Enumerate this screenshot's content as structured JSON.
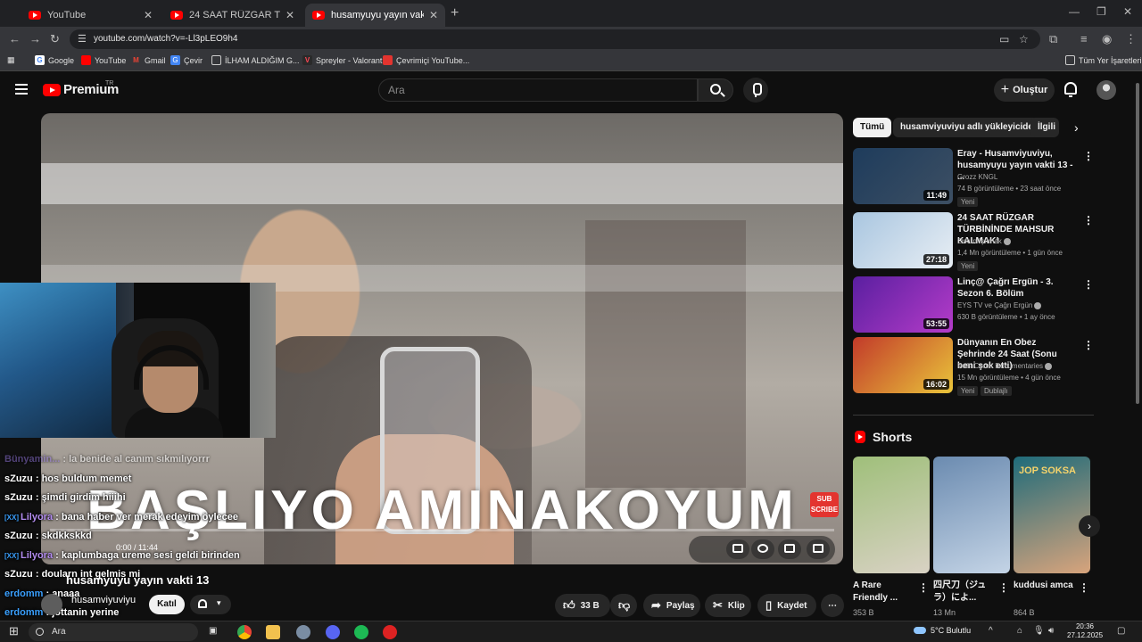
{
  "browser": {
    "tabs": [
      {
        "title": "YouTube",
        "active": false
      },
      {
        "title": "24 SAAT RÜZGAR TÜRBİNİNDE",
        "active": false
      },
      {
        "title": "husamyuyu yayın vakti 13 - You",
        "active": true
      }
    ],
    "url": "youtube.com/watch?v=-Ll3pLEO9h4",
    "bookmarks": [
      {
        "label": "Google",
        "icon": "google-icon"
      },
      {
        "label": "YouTube",
        "icon": "youtube-icon"
      },
      {
        "label": "Gmail",
        "icon": "gmail-icon"
      },
      {
        "label": "Çevir",
        "icon": "translate-icon"
      },
      {
        "label": "İLHAM ALDIĞIM G...",
        "icon": "folder-icon"
      },
      {
        "label": "Spreyler - Valorant",
        "icon": "valorant-icon"
      },
      {
        "label": "Çevrimiçi YouTube...",
        "icon": "converter-icon"
      }
    ],
    "all_bookmarks": "Tüm Yer İşaretleri"
  },
  "youtube": {
    "logo_text": "Premium",
    "logo_country": "TR",
    "search_placeholder": "Ara",
    "create_label": "Oluştur"
  },
  "video": {
    "overlay_text": "BAŞLIYO AMINAKOYUM",
    "sub_badge": [
      "SUB",
      "SCRIBE"
    ],
    "time": "0:00 / 11:44",
    "progress": 0.0,
    "title": "husamyuyu yayın vakti 13",
    "channel": "husamviyuviyu",
    "join_label": "Katıl",
    "actions": [
      {
        "icon": "like-icon",
        "label": "33 B"
      },
      {
        "icon": "dislike-icon",
        "label": ""
      },
      {
        "icon": "share-icon",
        "label": "Paylaş"
      },
      {
        "icon": "clip-icon",
        "label": "Klip"
      },
      {
        "icon": "save-icon",
        "label": "Kaydet"
      },
      {
        "icon": "more-icon",
        "label": ""
      }
    ]
  },
  "chat": [
    {
      "name": "Bünyamin...",
      "msg": ": la benide al canım sıkmılıyorrr",
      "color": "#8a6fd1",
      "faded": true,
      "tag": ""
    },
    {
      "name": "sZuzu",
      "msg": ": hos buldum memet",
      "color": "#ffffff",
      "faded": false,
      "tag": ""
    },
    {
      "name": "sZuzu",
      "msg": ": şimdi girdim hiiihi",
      "color": "#ffffff",
      "faded": false,
      "tag": ""
    },
    {
      "name": "Lilyora",
      "msg": ": bana haber ver merak edeyim öylecee",
      "color": "#b38cf0",
      "faded": false,
      "tag": "[XX]"
    },
    {
      "name": "sZuzu",
      "msg": ": skdkkskkd",
      "color": "#ffffff",
      "faded": false,
      "tag": ""
    },
    {
      "name": "Lilyora",
      "msg": ": kaplumbaga ureme sesi geldi birinden",
      "color": "#b38cf0",
      "faded": false,
      "tag": "[XX]"
    },
    {
      "name": "sZuzu",
      "msg": ": doularn int gelmis mi",
      "color": "#ffffff",
      "faded": false,
      "tag": ""
    },
    {
      "name": "erdomm",
      "msg": ": anaaa",
      "color": "#3aa0ff",
      "faded": false,
      "tag": ""
    },
    {
      "name": "erdomm",
      "msg": ": jottanin yerine",
      "color": "#3aa0ff",
      "faded": false,
      "tag": ""
    }
  ],
  "sidebar": {
    "chips": [
      {
        "label": "Tümü",
        "active": true
      },
      {
        "label": "husamviyuviyu adlı yükleyiciden",
        "active": false
      },
      {
        "label": "İlgili",
        "active": false
      }
    ],
    "recommendations": [
      {
        "title": "Eray - Husamviyuviyu, husamyuyu yayın vakti 13 - ...",
        "channel": "Grozz KNGL",
        "verified": false,
        "meta": "74 B görüntüleme • 23 saat önce",
        "badge": "Yeni",
        "badge2": "",
        "duration": "11:49",
        "thumb": [
          "#1e3c5c",
          "#3d4f63"
        ]
      },
      {
        "title": "24 SAAT RÜZGAR TÜRBİNİNDE MAHSUR KALMAK!",
        "channel": "Orkun Işıtmak",
        "verified": true,
        "meta": "1,4 Mn görüntüleme • 1 gün önce",
        "badge": "Yeni",
        "badge2": "",
        "duration": "27:18",
        "thumb": [
          "#a9c6e0",
          "#e8eef4"
        ]
      },
      {
        "title": "Linç@ Çağrı Ergün - 3. Sezon 6. Bölüm",
        "channel": "EYS TV ve Çağrı Ergün",
        "verified": true,
        "meta": "630 B görüntüleme • 1 ay önce",
        "badge": "",
        "badge2": "",
        "duration": "53:55",
        "thumb": [
          "#5a1fa0",
          "#b53cc9"
        ]
      },
      {
        "title": "Dünyanın En Obez Şehrinde 24 Saat (Sonu beni şok etti)",
        "channel": "Ruhi Cenet Documentaries",
        "verified": true,
        "meta": "15 Mn görüntüleme • 4 gün önce",
        "badge": "Yeni",
        "badge2": "Dublajlı",
        "duration": "16:02",
        "thumb": [
          "#c23a2a",
          "#e9c43a"
        ]
      }
    ],
    "shorts_label": "Shorts",
    "shorts": [
      {
        "title": "A Rare Friendly ...",
        "views": "353 B",
        "thumb": [
          "#9fbf7a",
          "#d9d2c4"
        ]
      },
      {
        "title": "四尺刀（ジュラ）によ...",
        "views": "13 Mn",
        "thumb": [
          "#6b8bb0",
          "#c4d4e6"
        ]
      },
      {
        "title": "kuddusi amca",
        "views": "864 B",
        "thumb": [
          "#1f6b7a",
          "#d8a47c"
        ],
        "overlay": "JOP SOKSA"
      }
    ]
  },
  "taskbar": {
    "search": "Ara",
    "weather": "5°C Bulutlu",
    "time": "20:36",
    "date": "27.12.2025"
  }
}
